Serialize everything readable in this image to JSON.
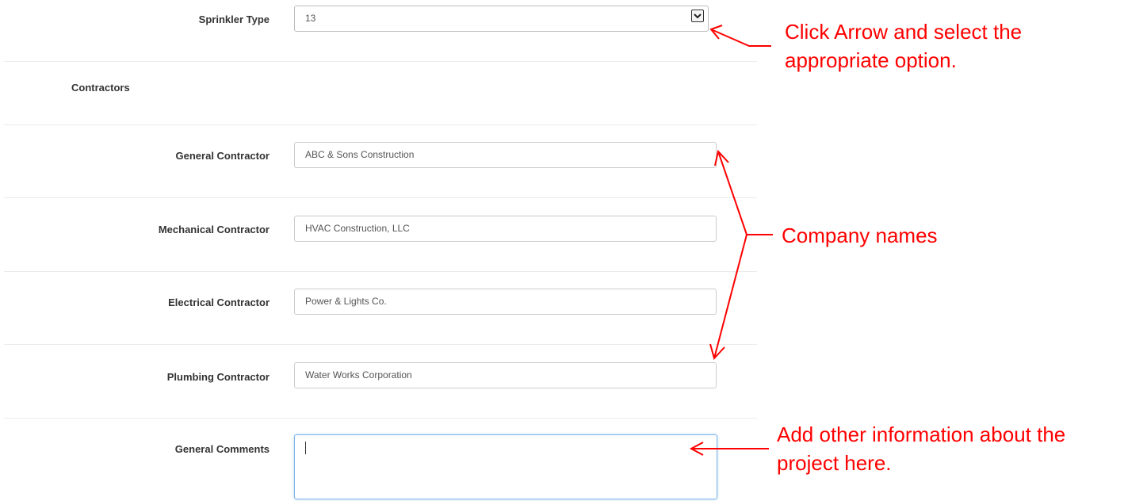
{
  "form": {
    "sprinkler": {
      "label": "Sprinkler Type",
      "value": "13"
    },
    "contractors_section": "Contractors",
    "general_contractor": {
      "label": "General Contractor",
      "value": "ABC & Sons Construction"
    },
    "mechanical_contractor": {
      "label": "Mechanical Contractor",
      "value": "HVAC Construction, LLC"
    },
    "electrical_contractor": {
      "label": "Electrical Contractor",
      "value": "Power & Lights Co."
    },
    "plumbing_contractor": {
      "label": "Plumbing Contractor",
      "value": "Water Works Corporation"
    },
    "general_comments": {
      "label": "General Comments",
      "value": ""
    }
  },
  "annotations": {
    "select_hint_line1": "Click Arrow and select the",
    "select_hint_line2": "appropriate option.",
    "company_names": "Company names",
    "comments_hint_line1": "Add other information about the",
    "comments_hint_line2": "project here."
  },
  "colors": {
    "annotation": "#ff0000",
    "focus_border": "#7db3e6"
  },
  "icons": {
    "select_arrow": "chevron-down-icon"
  }
}
